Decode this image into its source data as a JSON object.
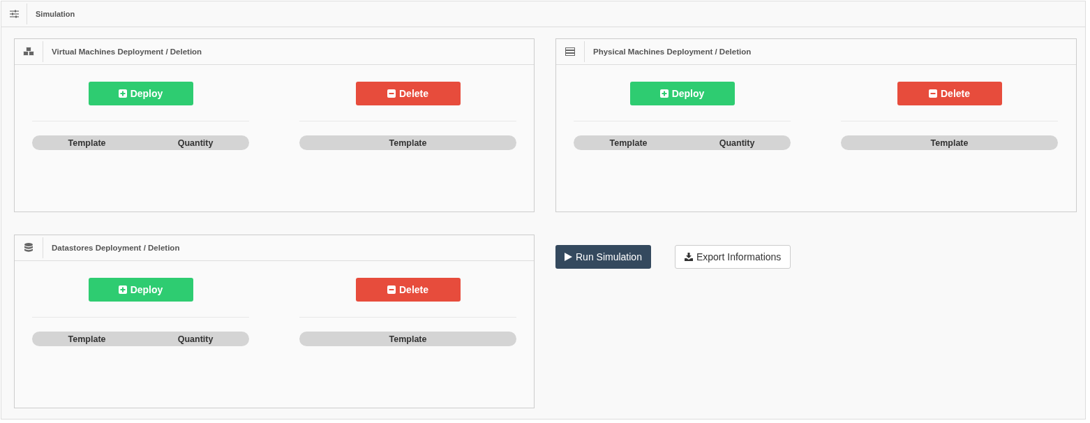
{
  "panel_title": "Simulation",
  "sections": [
    {
      "kind": "cubes",
      "title": "Virtual Machines Deployment / Deletion",
      "deploy": {
        "label": "Deploy",
        "columns": [
          "Template",
          "Quantity"
        ]
      },
      "delete": {
        "label": "Delete",
        "columns": [
          "Template"
        ]
      }
    },
    {
      "kind": "servers",
      "title": "Physical Machines Deployment / Deletion",
      "deploy": {
        "label": "Deploy",
        "columns": [
          "Template",
          "Quantity"
        ]
      },
      "delete": {
        "label": "Delete",
        "columns": [
          "Template"
        ]
      }
    },
    {
      "kind": "database",
      "title": "Datastores Deployment / Deletion",
      "deploy": {
        "label": "Deploy",
        "columns": [
          "Template",
          "Quantity"
        ]
      },
      "delete": {
        "label": "Delete",
        "columns": [
          "Template"
        ]
      }
    }
  ],
  "actions": {
    "run": "Run Simulation",
    "export": "Export Informations"
  }
}
